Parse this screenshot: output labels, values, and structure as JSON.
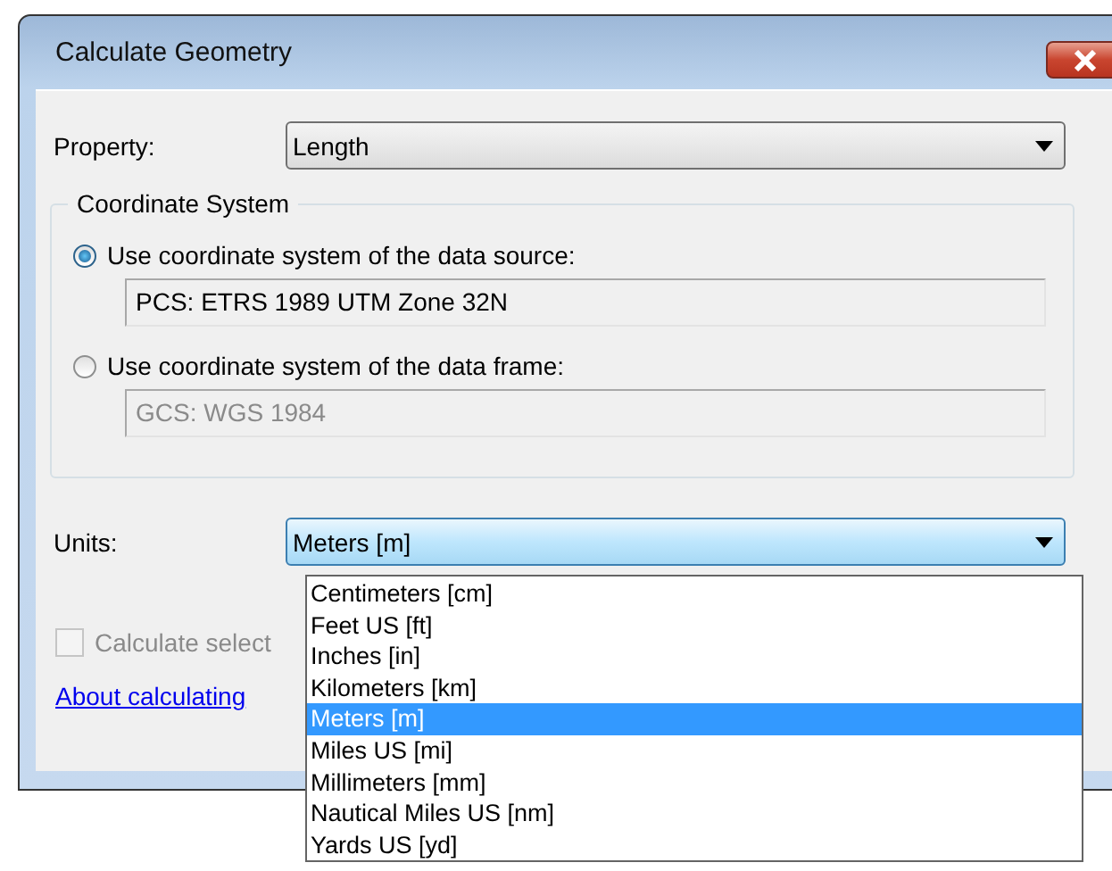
{
  "window": {
    "title": "Calculate Geometry"
  },
  "property": {
    "label": "Property:",
    "value": "Length"
  },
  "coordinate_system": {
    "title": "Coordinate System",
    "options": [
      {
        "label": "Use coordinate system of the data source:",
        "selected": true,
        "value": "PCS: ETRS 1989 UTM Zone 32N"
      },
      {
        "label": "Use coordinate system of the data frame:",
        "selected": false,
        "value": "GCS: WGS 1984"
      }
    ]
  },
  "units": {
    "label": "Units:",
    "value": "Meters [m]",
    "expanded": true,
    "options": [
      {
        "label": "Centimeters [cm]",
        "selected": false
      },
      {
        "label": "Feet US [ft]",
        "selected": false
      },
      {
        "label": "Inches [in]",
        "selected": false
      },
      {
        "label": "Kilometers [km]",
        "selected": false
      },
      {
        "label": "Meters [m]",
        "selected": true
      },
      {
        "label": "Miles US [mi]",
        "selected": false
      },
      {
        "label": "Millimeters [mm]",
        "selected": false
      },
      {
        "label": "Nautical Miles US [nm]",
        "selected": false
      },
      {
        "label": "Yards US [yd]",
        "selected": false
      }
    ]
  },
  "checkbox": {
    "label": "Calculate select",
    "checked": false,
    "disabled": true
  },
  "link": {
    "text": "About calculating"
  }
}
